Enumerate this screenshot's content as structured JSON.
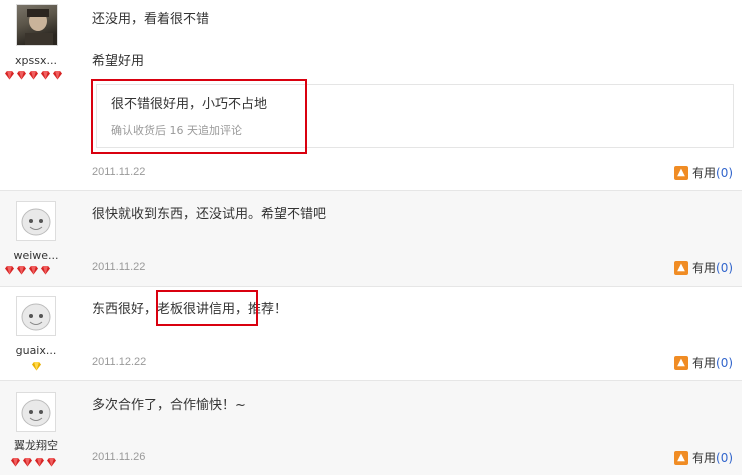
{
  "colors": {
    "highlight_border": "#d9000f",
    "accent_count": "#3366cc",
    "thumb": "#f08c24"
  },
  "reviews": [
    {
      "username": "xpssx...",
      "gem_count": 5,
      "gem_icon": "red-diamond-icon",
      "lines": [
        "还没用，看着很不错",
        "希望好用"
      ],
      "append": {
        "text": "很不错很好用，小巧不占地",
        "note": "确认收货后 16 天追加评论"
      },
      "date": "2011.11.22",
      "useful_label": "有用",
      "useful_count": "(0)"
    },
    {
      "username": "weiwe...",
      "gem_count": 4,
      "gem_icon": "red-diamond-icon",
      "lines": [
        "很快就收到东西，还没试用。希望不错吧"
      ],
      "date": "2011.11.22",
      "useful_label": "有用",
      "useful_count": "(0)"
    },
    {
      "username": "guaix...",
      "gem_count": 1,
      "gem_icon": "yellow-heart-icon",
      "text_before": "东西很好，",
      "text_highlight": "老板很讲信用，",
      "text_after": "推荐！",
      "date": "2011.12.22",
      "useful_label": "有用",
      "useful_count": "(0)"
    },
    {
      "username": "翼龙翔空",
      "gem_count": 4,
      "gem_icon": "red-diamond-icon",
      "lines": [
        "多次合作了，合作愉快！~"
      ],
      "date": "2011.11.26",
      "useful_label": "有用",
      "useful_count": "(0)"
    }
  ]
}
